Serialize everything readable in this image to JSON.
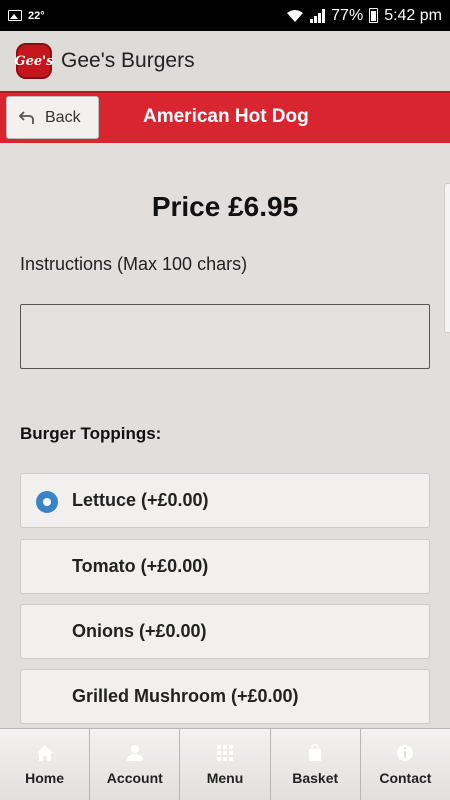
{
  "status_bar": {
    "temperature": "22°",
    "battery": "77%",
    "time": "5:42 pm"
  },
  "app_bar": {
    "logo_text": "Gee's",
    "title": "Gee's Burgers"
  },
  "header": {
    "back_label": "Back",
    "title": "American Hot Dog"
  },
  "content": {
    "price": "Price £6.95",
    "instructions_label": "Instructions (Max 100 chars)",
    "instructions_value": "",
    "toppings_label": "Burger Toppings:",
    "options": [
      {
        "label": "Lettuce (+£0.00)",
        "selected": true
      },
      {
        "label": "Tomato (+£0.00)",
        "selected": false
      },
      {
        "label": "Onions (+£0.00)",
        "selected": false
      },
      {
        "label": "Grilled Mushroom (+£0.00)",
        "selected": false
      }
    ]
  },
  "bottom_nav": [
    {
      "label": "Home",
      "icon": "home-icon"
    },
    {
      "label": "Account",
      "icon": "user-icon"
    },
    {
      "label": "Menu",
      "icon": "grid-icon"
    },
    {
      "label": "Basket",
      "icon": "bag-icon"
    },
    {
      "label": "Contact",
      "icon": "info-icon"
    }
  ],
  "colors": {
    "accent_red": "#d9252f",
    "radio_blue": "#3b83c9"
  }
}
